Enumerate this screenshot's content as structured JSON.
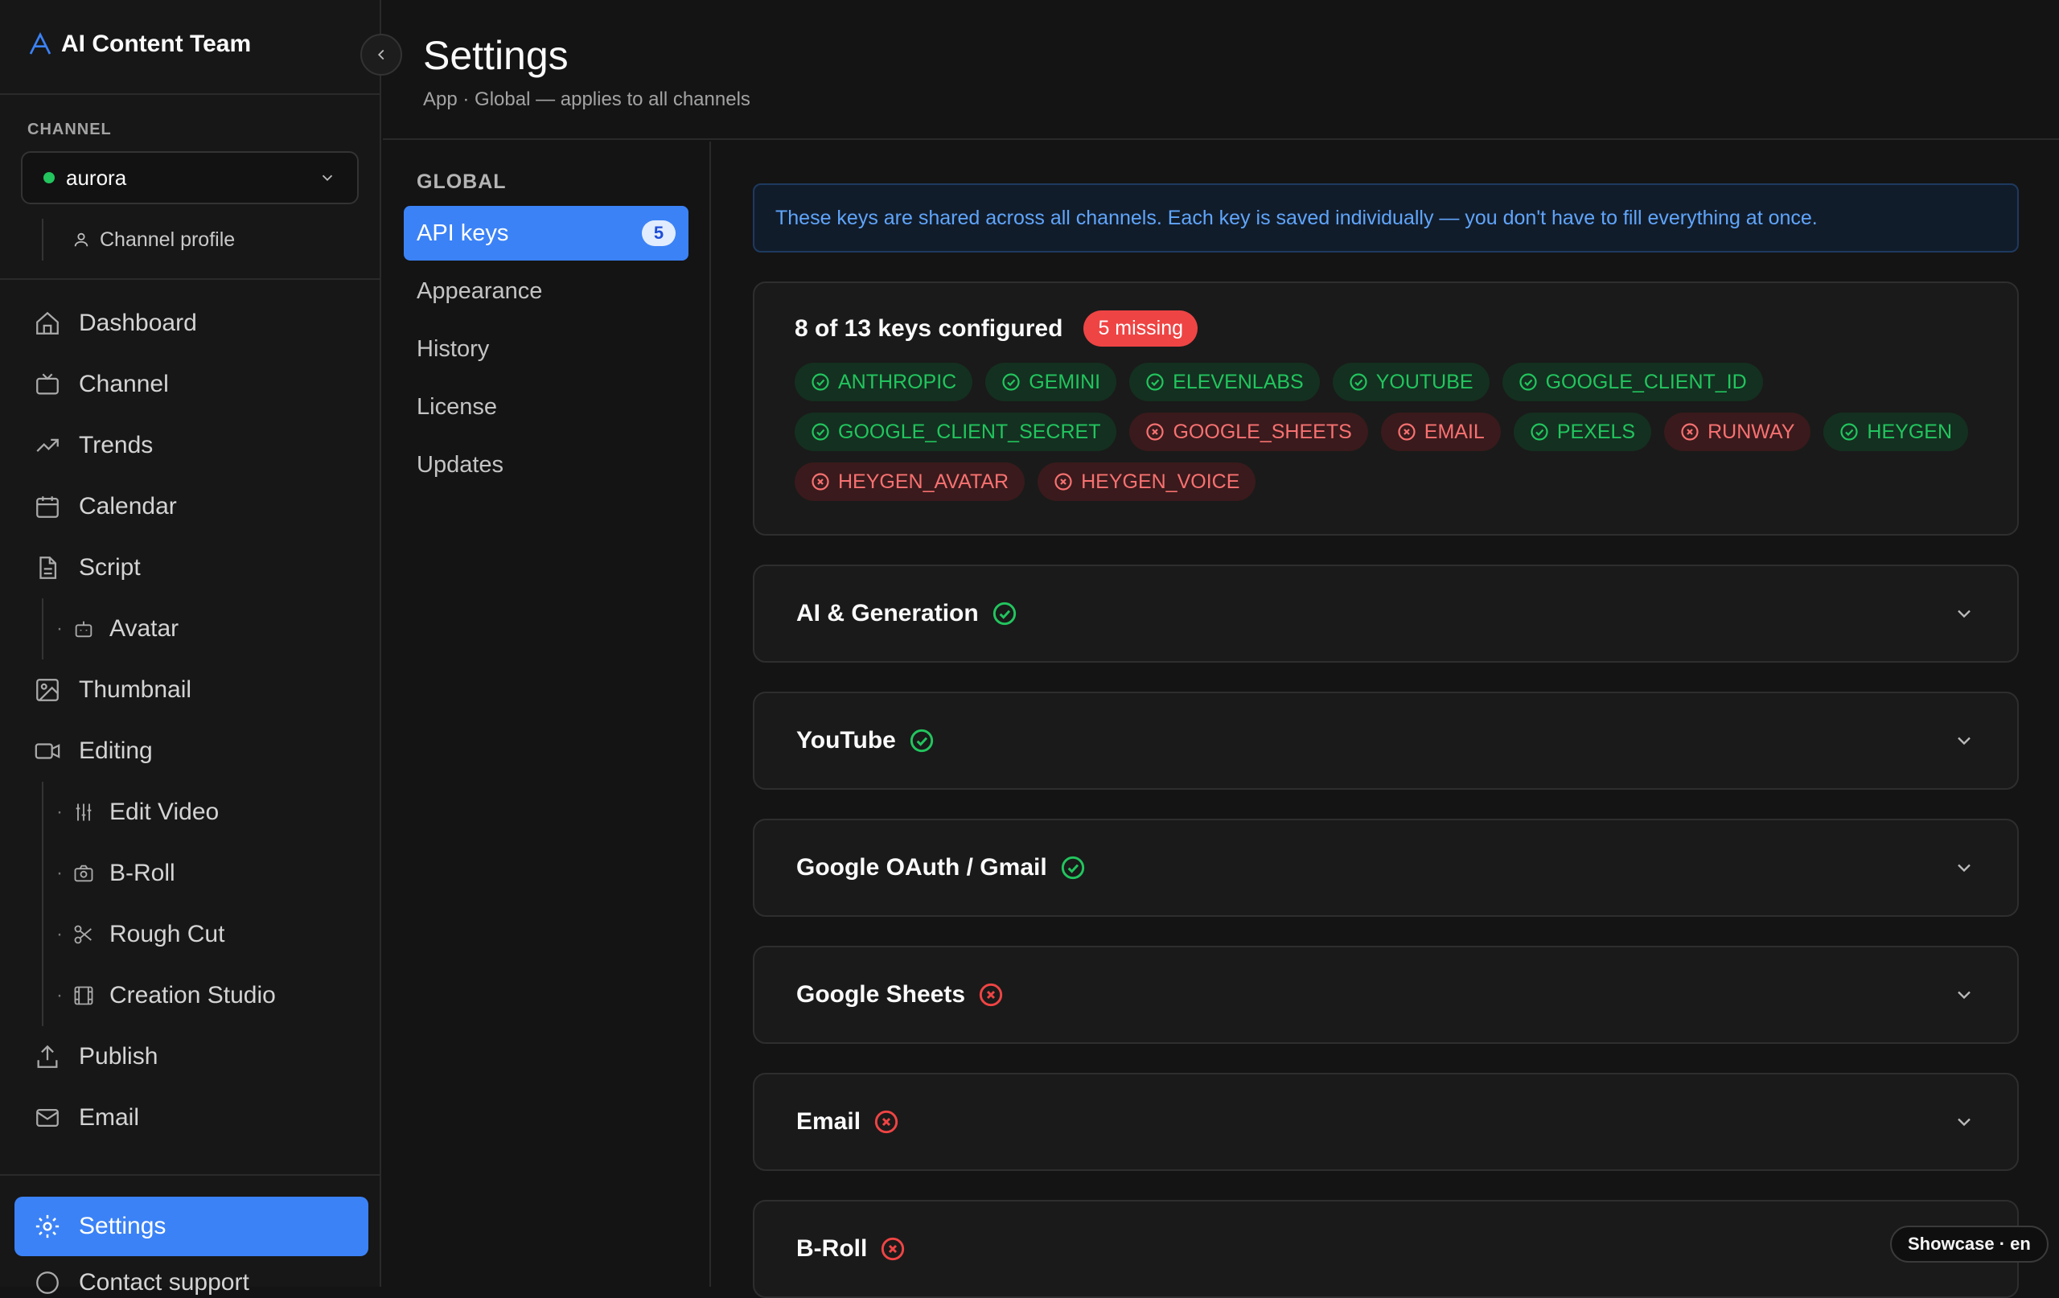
{
  "app": {
    "title": "AI Content Team",
    "logo_icon": "logo-a-icon"
  },
  "sidebar": {
    "channel_label": "CHANNEL",
    "channel_value": "aurora",
    "channel_profile": "Channel profile",
    "items": [
      {
        "label": "Dashboard",
        "icon": "home-icon"
      },
      {
        "label": "Channel",
        "icon": "tv-icon"
      },
      {
        "label": "Trends",
        "icon": "trending-up-icon"
      },
      {
        "label": "Calendar",
        "icon": "calendar-icon"
      },
      {
        "label": "Script",
        "icon": "file-text-icon"
      },
      {
        "label": "Avatar",
        "icon": "bot-icon"
      },
      {
        "label": "Thumbnail",
        "icon": "image-icon"
      },
      {
        "label": "Editing",
        "icon": "video-icon"
      },
      {
        "label": "Edit Video",
        "icon": "sliders-icon"
      },
      {
        "label": "B-Roll",
        "icon": "camera-icon"
      },
      {
        "label": "Rough Cut",
        "icon": "scissors-icon"
      },
      {
        "label": "Creation Studio",
        "icon": "film-icon"
      },
      {
        "label": "Publish",
        "icon": "upload-icon"
      },
      {
        "label": "Email",
        "icon": "mail-icon"
      }
    ],
    "settings_label": "Settings",
    "support_label": "Contact support"
  },
  "header": {
    "title": "Settings",
    "subtitle": "App · Global — applies to all channels"
  },
  "subnav": {
    "section_label": "GLOBAL",
    "items": [
      {
        "label": "API keys",
        "badge": "5"
      },
      {
        "label": "Appearance"
      },
      {
        "label": "History"
      },
      {
        "label": "License"
      },
      {
        "label": "Updates"
      }
    ]
  },
  "main": {
    "info_text": "These keys are shared across all channels. Each key is saved individually — you don't have to fill everything at once.",
    "summary_title": "8 of 13 keys configured",
    "missing_badge": "5 missing",
    "keys": [
      {
        "name": "ANTHROPIC",
        "status": "ok"
      },
      {
        "name": "GEMINI",
        "status": "ok"
      },
      {
        "name": "ELEVENLABS",
        "status": "ok"
      },
      {
        "name": "YOUTUBE",
        "status": "ok"
      },
      {
        "name": "GOOGLE_CLIENT_ID",
        "status": "ok"
      },
      {
        "name": "GOOGLE_CLIENT_SECRET",
        "status": "ok"
      },
      {
        "name": "GOOGLE_SHEETS",
        "status": "missing"
      },
      {
        "name": "EMAIL",
        "status": "missing"
      },
      {
        "name": "PEXELS",
        "status": "ok"
      },
      {
        "name": "RUNWAY",
        "status": "missing"
      },
      {
        "name": "HEYGEN",
        "status": "ok"
      },
      {
        "name": "HEYGEN_AVATAR",
        "status": "missing"
      },
      {
        "name": "HEYGEN_VOICE",
        "status": "missing"
      }
    ],
    "sections": [
      {
        "title": "AI & Generation",
        "status": "ok"
      },
      {
        "title": "YouTube",
        "status": "ok"
      },
      {
        "title": "Google OAuth / Gmail",
        "status": "ok"
      },
      {
        "title": "Google Sheets",
        "status": "missing"
      },
      {
        "title": "Email",
        "status": "missing"
      },
      {
        "title": "B-Roll",
        "status": "missing"
      }
    ]
  },
  "showcase": "Showcase · en",
  "colors": {
    "accent": "#3b82f6",
    "ok": "#22c55e",
    "missing": "#ef4444",
    "info": "#60a5fa"
  }
}
